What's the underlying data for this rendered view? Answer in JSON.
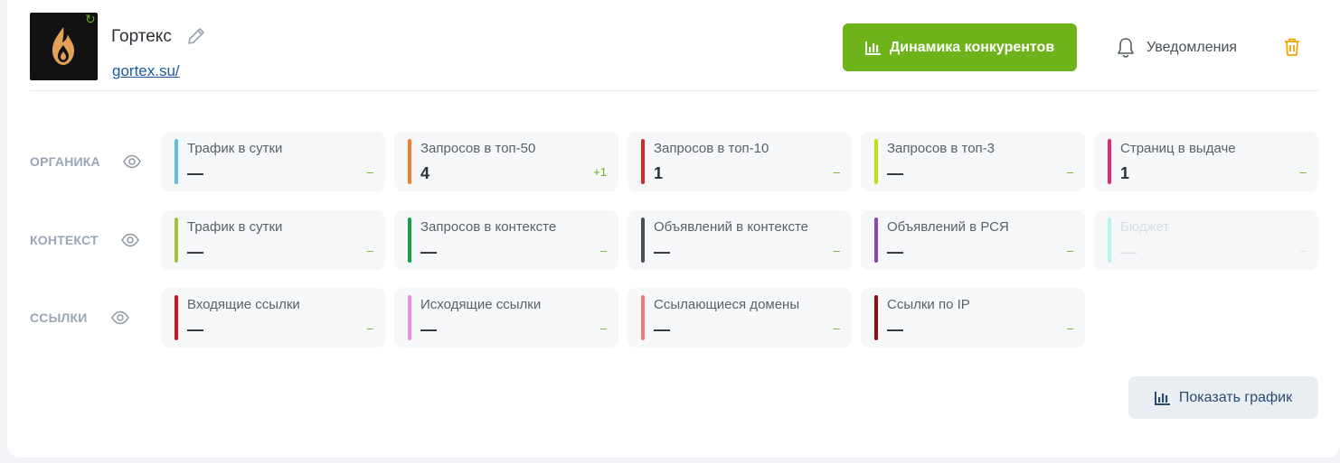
{
  "site": {
    "name": "Гортекс",
    "url": "gortex.su/"
  },
  "header": {
    "competitors_label": "Динамика конкурентов",
    "notifications_label": "Уведомления"
  },
  "rows": [
    {
      "label": "ОРГАНИКА",
      "metrics": [
        {
          "title": "Трафик в сутки",
          "value": "—",
          "delta": "–",
          "color": "#5bc0eb"
        },
        {
          "title": "Запросов в топ-50",
          "value": "4",
          "delta": "+1",
          "color": "#f07f2d"
        },
        {
          "title": "Запросов в топ-10",
          "value": "1",
          "delta": "–",
          "color": "#d12a2a"
        },
        {
          "title": "Запросов в топ-3",
          "value": "—",
          "delta": "–",
          "color": "#c6dc12"
        },
        {
          "title": "Страниц в выдаче",
          "value": "1",
          "delta": "–",
          "color": "#e02a77"
        }
      ]
    },
    {
      "label": "КОНТЕКСТ",
      "metrics": [
        {
          "title": "Трафик в сутки",
          "value": "—",
          "delta": "–",
          "color": "#a7c23a"
        },
        {
          "title": "Запросов в контексте",
          "value": "—",
          "delta": "–",
          "color": "#17a04b"
        },
        {
          "title": "Объявлений в контексте",
          "value": "—",
          "delta": "–",
          "color": "#4a4e54"
        },
        {
          "title": "Объявлений в РСЯ",
          "value": "—",
          "delta": "–",
          "color": "#8a45b5"
        },
        {
          "title": "Бюджет",
          "value": "—",
          "delta": "–",
          "color": "#b9f1f3"
        }
      ]
    },
    {
      "label": "ССЫЛКИ",
      "metrics": [
        {
          "title": "Входящие ссылки",
          "value": "—",
          "delta": "–",
          "color": "#d3141c"
        },
        {
          "title": "Исходящие ссылки",
          "value": "—",
          "delta": "–",
          "color": "#ec8be0"
        },
        {
          "title": "Ссылающиеся домены",
          "value": "—",
          "delta": "–",
          "color": "#ec7d7d"
        },
        {
          "title": "Ссылки по IP",
          "value": "—",
          "delta": "–",
          "color": "#8e0d14"
        }
      ]
    }
  ],
  "show_chart_label": "Показать график",
  "colors": {
    "accent_green": "#6fb31b",
    "link_blue": "#1b5b9e",
    "delete_orange": "#f0a500"
  },
  "icons": [
    "flame-logo",
    "refresh-icon",
    "edit-icon",
    "chart-icon",
    "bell-icon",
    "trash-icon",
    "eye-icon"
  ]
}
